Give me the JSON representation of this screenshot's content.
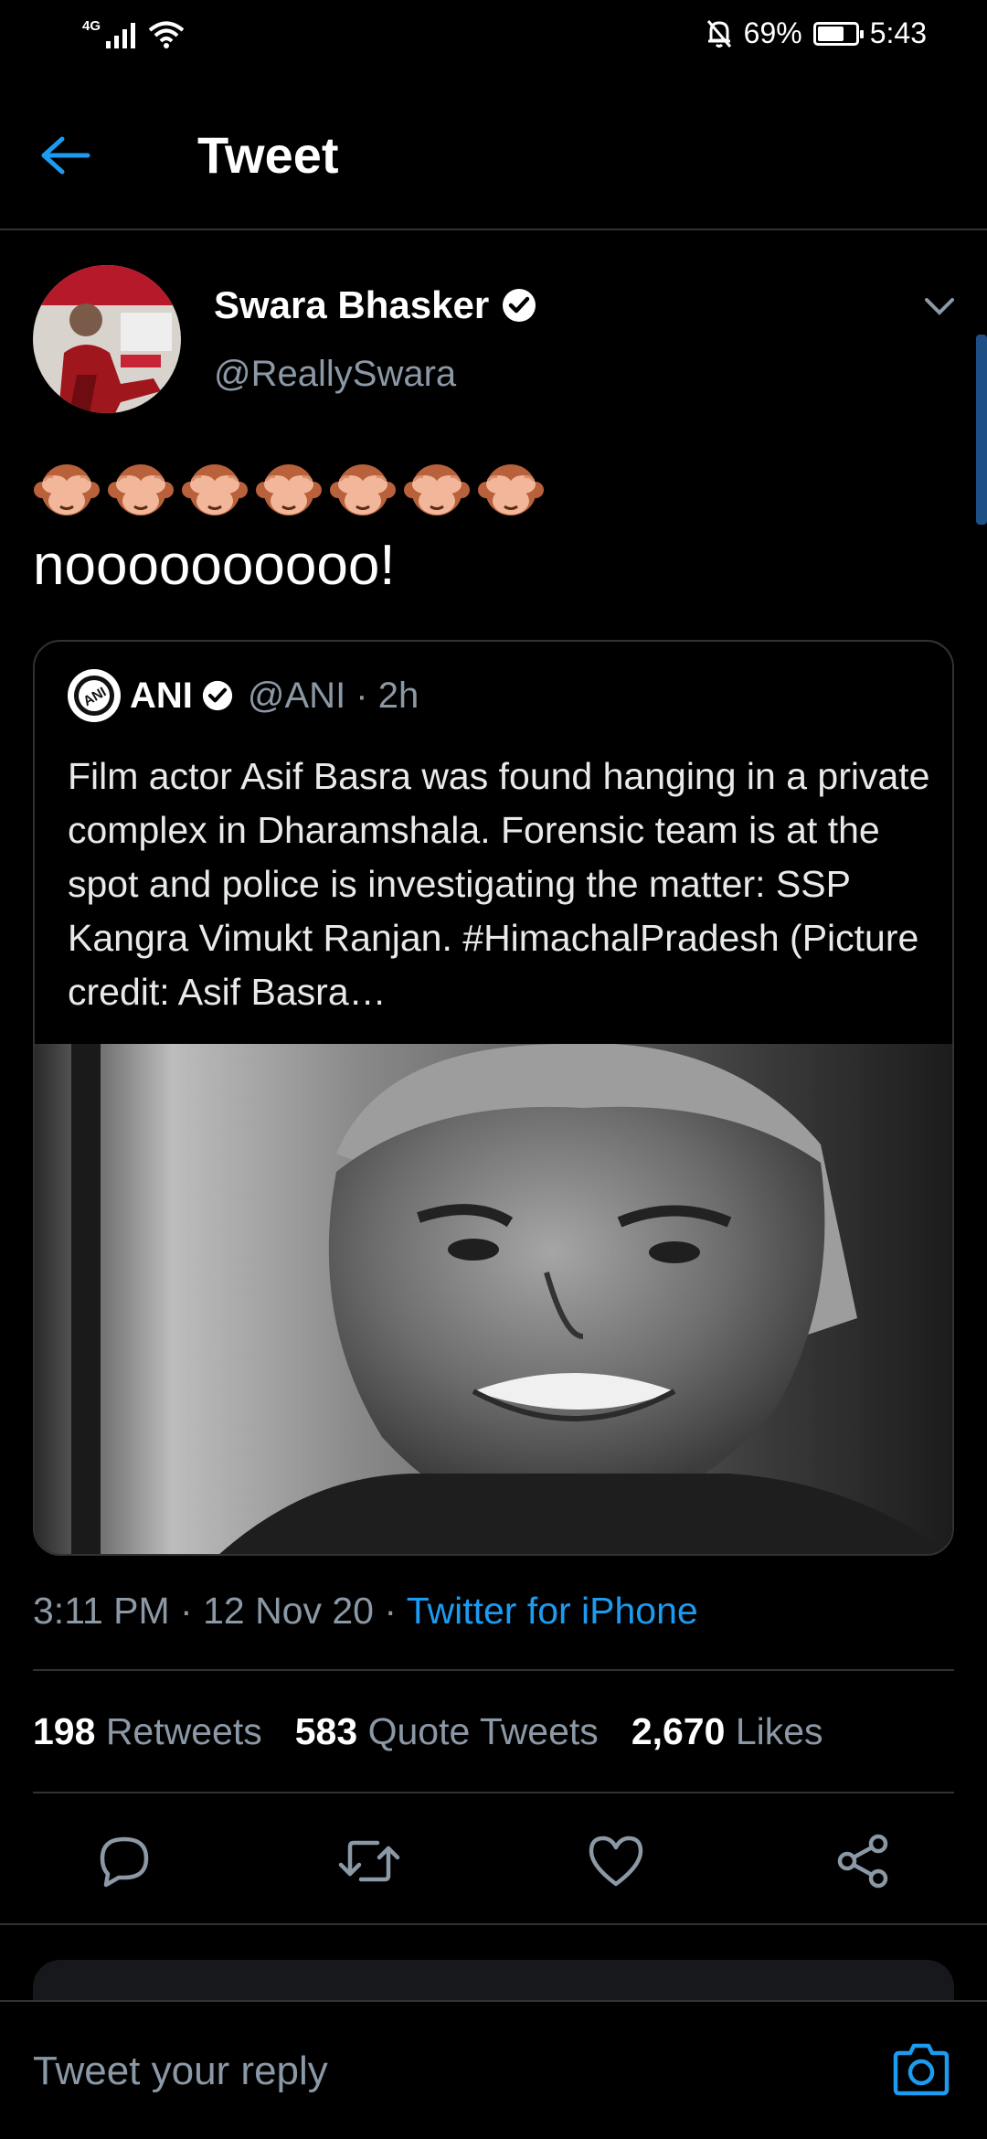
{
  "status_bar": {
    "network": "4G",
    "battery": "69%",
    "battery_level": 0.69,
    "time": "5:43"
  },
  "header": {
    "back_icon": "arrow-left-icon",
    "title": "Tweet"
  },
  "tweet": {
    "author_name": "Swara Bhasker",
    "verified": true,
    "handle": "@ReallySwara",
    "emojis": [
      "🙈",
      "🙈",
      "🙈",
      "🙈",
      "🙈",
      "🙈",
      "🙈"
    ],
    "text": "noooooooooo!",
    "timestamp": "3:11 PM · 12 Nov 20 · ",
    "source": "Twitter for iPhone"
  },
  "quoted_tweet": {
    "name": "ANI",
    "verified": true,
    "handle_time": "@ANI · 2h",
    "text": "Film actor Asif Basra was found hanging in a private complex in Dharamshala. Forensic team is at the spot and police is investigating the matter: SSP Kangra Vimukt Ranjan. #HimachalPradesh (Picture credit: Asif Basra…"
  },
  "stats": {
    "retweets_count": "198",
    "retweets_label": "Retweets",
    "quotes_count": "583",
    "quotes_label": "Quote Tweets",
    "likes_count": "2,670",
    "likes_label": "Likes"
  },
  "actions": [
    "reply-icon",
    "retweet-icon",
    "like-icon",
    "share-icon"
  ],
  "reply": {
    "placeholder": "Tweet your reply"
  },
  "colors": {
    "background": "#000000",
    "accent": "#1d9bf0",
    "muted_text": "#8b98a5",
    "divider": "#2f3336"
  }
}
